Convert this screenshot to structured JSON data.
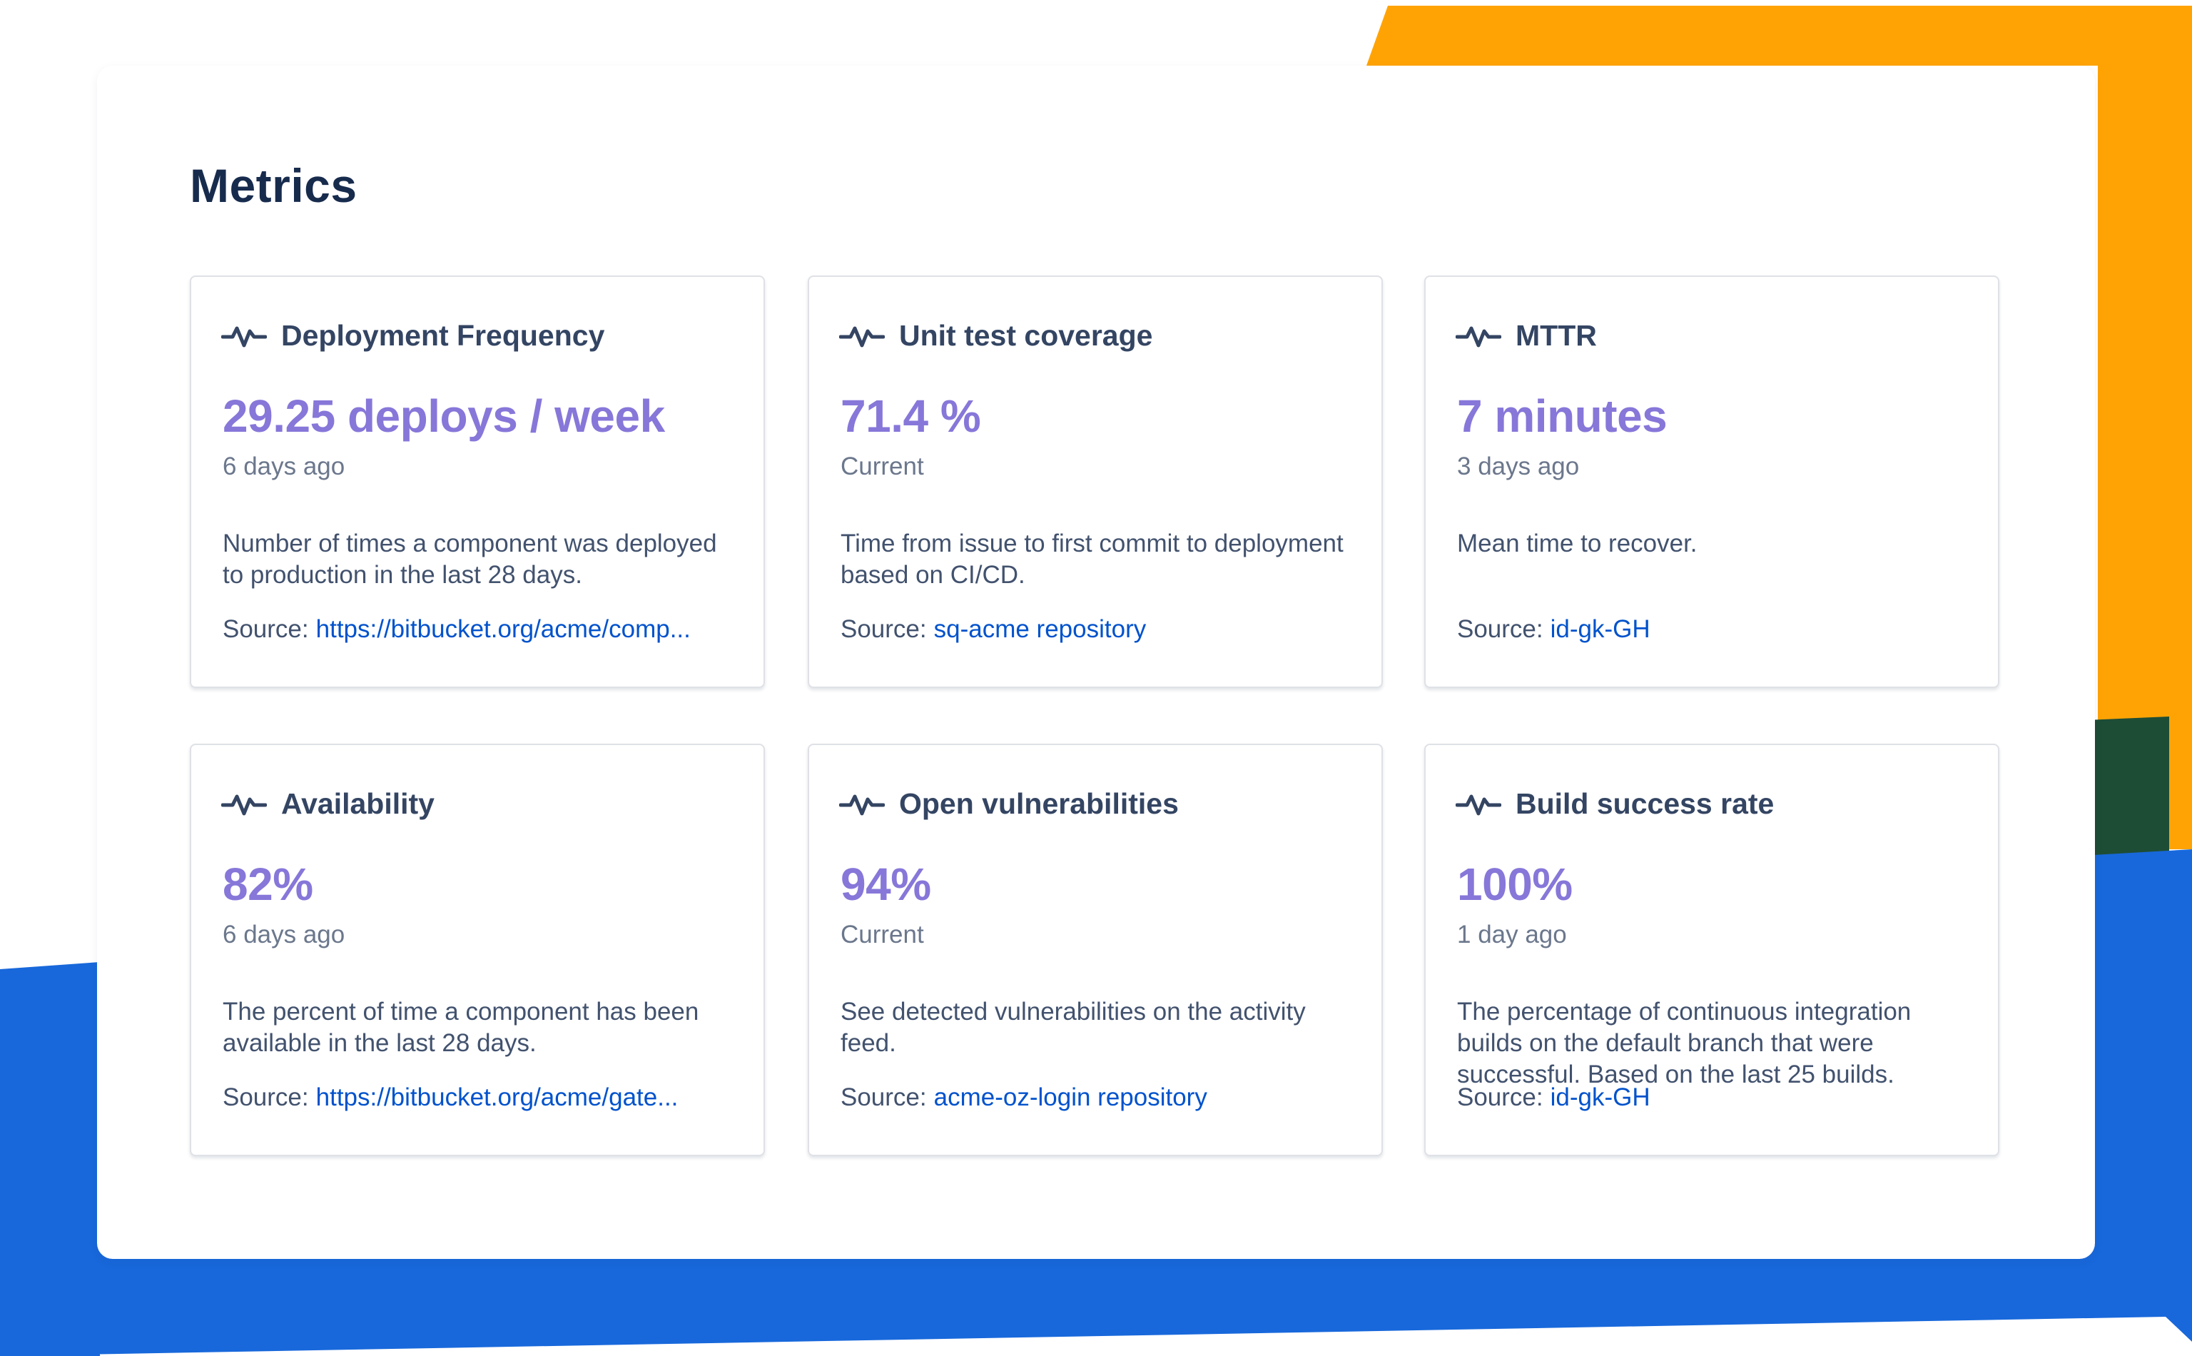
{
  "page": {
    "title": "Metrics",
    "colors": {
      "accent_orange": "#ffa305",
      "accent_blue": "#1868db",
      "accent_green": "#1e4d36",
      "value_purple": "#8777d9",
      "link_blue": "#0052cc"
    }
  },
  "metrics": [
    {
      "title": "Deployment Frequency",
      "value": "29.25 deploys / week",
      "time": "6 days ago",
      "description": "Number of times a component was deployed to production in the last 28 days.",
      "source_label": "Source:",
      "source_link": "https://bitbucket.org/acme/comp...",
      "icon": "pulse-icon"
    },
    {
      "title": "Unit test coverage",
      "value": "71.4 %",
      "time": "Current",
      "description": "Time from issue to first commit to deployment based on CI/CD.",
      "source_label": "Source:",
      "source_link": "sq-acme repository",
      "icon": "pulse-icon"
    },
    {
      "title": "MTTR",
      "value": "7 minutes",
      "time": "3 days ago",
      "description": "Mean time to recover.",
      "source_label": "Source:",
      "source_link": "id-gk-GH",
      "icon": "pulse-icon"
    },
    {
      "title": "Availability",
      "value": "82%",
      "time": "6 days ago",
      "description": "The percent of time a component has been available in the last 28 days.",
      "source_label": "Source:",
      "source_link": "https://bitbucket.org/acme/gate...",
      "icon": "pulse-icon"
    },
    {
      "title": "Open vulnerabilities",
      "value": "94%",
      "time": "Current",
      "description": "See detected vulnerabilities on the activity feed.",
      "source_label": "Source:",
      "source_link": "acme-oz-login repository",
      "icon": "pulse-icon"
    },
    {
      "title": "Build success rate",
      "value": "100%",
      "time": "1 day ago",
      "description": "The percentage of continuous integration builds on the default branch that were successful. Based on the last 25 builds.",
      "source_label": "Source:",
      "source_link": "id-gk-GH",
      "icon": "pulse-icon"
    }
  ]
}
